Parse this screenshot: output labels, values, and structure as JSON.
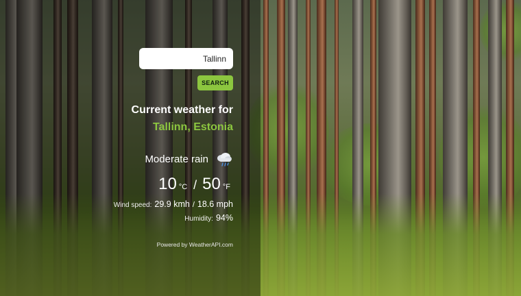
{
  "search": {
    "value": "Tallinn",
    "button_label": "SEARCH"
  },
  "weather": {
    "heading": "Current weather for",
    "location": "Tallinn, Estonia",
    "condition": "Moderate rain",
    "condition_icon": "rain-cloud-icon",
    "temp_c": "10",
    "unit_c": "°C",
    "temp_separator": "/",
    "temp_f": "50",
    "unit_f": "°F",
    "wind_label": "Wind speed:",
    "wind_kmh": "29.9 kmh",
    "wind_separator": "/",
    "wind_mph": "18.6 mph",
    "humidity_label": "Humidity:",
    "humidity_value": "94%"
  },
  "footer": {
    "powered_by": "Powered by WeatherAPI.com"
  },
  "colors": {
    "accent": "#8cc63f",
    "overlay": "rgba(0,0,0,0.42)"
  }
}
